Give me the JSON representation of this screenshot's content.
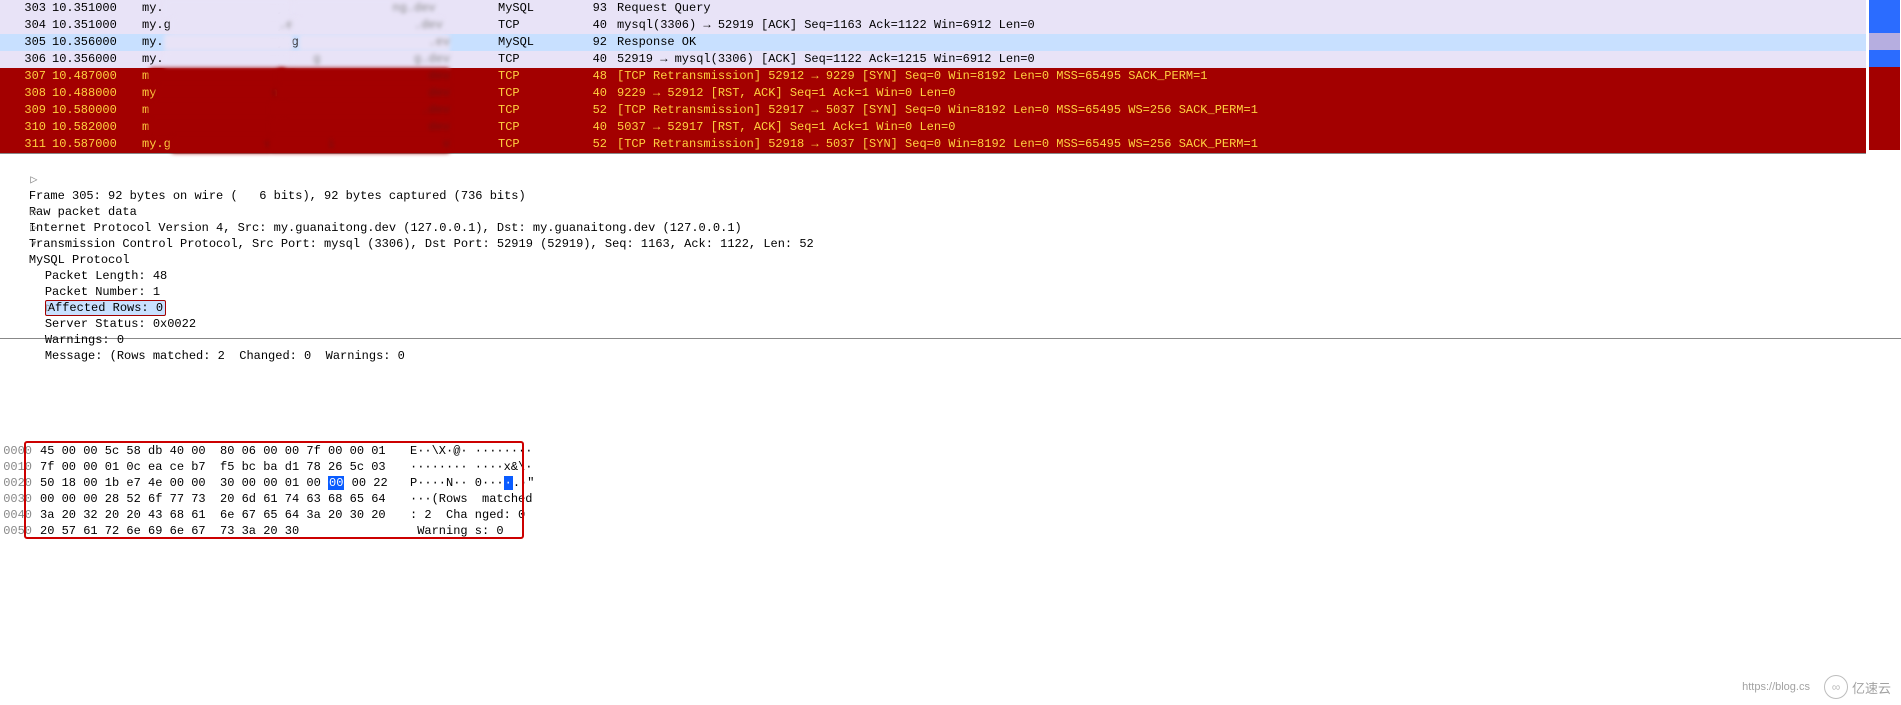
{
  "packet_list": [
    {
      "no": "303",
      "time": "10.351000",
      "src": "my.",
      "src_fade": "                  ",
      "dst": "my.",
      "dst_fade": "              ng.dev",
      "proto": "MySQL",
      "len": "93",
      "info": "Request Query",
      "cls": "normal"
    },
    {
      "no": "304",
      "time": "10.351000",
      "src": "my.g",
      "src_fade": "               .ev",
      "dst": "my.",
      "dst_fade": "                 .dev",
      "proto": "TCP",
      "len": "40",
      "info": "mysql(3306) → 52919 [ACK] Seq=1163 Ack=1122 Win=6912 Len=0",
      "cls": "normal"
    },
    {
      "no": "305",
      "time": "10.356000",
      "src": "my.",
      "src_fade": "                  ",
      "dst": "my.g",
      "dst_fade": "                  .ev",
      "proto": "MySQL",
      "len": "92",
      "info": "Response OK",
      "cls": "selected"
    },
    {
      "no": "306",
      "time": "10.356000",
      "src": "my.",
      "src_fade": "                  ",
      "dst": "my.",
      "dst_fade": "   g             g.dev",
      "proto": "TCP",
      "len": "40",
      "info": "52919 → mysql(3306) [ACK] Seq=1122 Ack=1215 Win=6912 Len=0",
      "cls": "normal"
    },
    {
      "no": "307",
      "time": "10.487000",
      "src": "m",
      "src_fade": "                   ",
      "dst": "m",
      "dst_fade": "                     dev",
      "proto": "TCP",
      "len": "48",
      "info": "[TCP Retransmission] 52912 → 9229 [SYN] Seq=0 Win=8192 Len=0 MSS=65495 SACK_PERM=1",
      "cls": "red"
    },
    {
      "no": "308",
      "time": "10.488000",
      "src": "my",
      "src_fade": "                v",
      "dst": "m",
      "dst_fade": "                     dev",
      "proto": "TCP",
      "len": "40",
      "info": "9229 → 52912 [RST, ACK] Seq=1 Ack=1 Win=0 Len=0",
      "cls": "red"
    },
    {
      "no": "309",
      "time": "10.580000",
      "src": "m",
      "src_fade": "                   ",
      "dst": "",
      "dst_fade": "                     .dev",
      "proto": "TCP",
      "len": "52",
      "info": "[TCP Retransmission] 52917 → 5037 [SYN] Seq=0 Win=8192 Len=0 MSS=65495 WS=256 SACK_PERM=1",
      "cls": "red"
    },
    {
      "no": "310",
      "time": "10.582000",
      "src": "m",
      "src_fade": "                   ",
      "dst": "",
      "dst_fade": "                      dev",
      "proto": "TCP",
      "len": "40",
      "info": "5037 → 52917 [RST, ACK] Seq=1 Ack=1 Win=0 Len=0",
      "cls": "red"
    },
    {
      "no": "311",
      "time": "10.587000",
      "src": "my.g",
      "src_fade": "             v",
      "dst": "",
      "dst_fade": "        i               v",
      "proto": "TCP",
      "len": "52",
      "info": "[TCP Retransmission] 52918 → 5037 [SYN] Seq=0 Win=8192 Len=0 MSS=65495 WS=256 SACK_PERM=1",
      "cls": "red"
    }
  ],
  "details": {
    "frame": "Frame 305: 92 bytes on wire (   6 bits), 92 bytes captured (736 bits)",
    "raw": "Raw packet data",
    "ip": "Internet Protocol Version 4, Src: my.guanaitong.dev (127.0.0.1), Dst: my.guanaitong.dev (127.0.0.1)",
    "tcp": "Transmission Control Protocol, Src Port: mysql (3306), Dst Port: 52919 (52919), Seq: 1163, Ack: 1122, Len: 52",
    "mysql_root": "MySQL Protocol",
    "packet_length": "Packet Length: 48",
    "packet_number": "Packet Number: 1",
    "affected_rows": "Affected Rows: 0",
    "server_status": "Server Status: 0x0022",
    "warnings": "Warnings: 0",
    "message": "Message: (Rows matched: 2  Changed: 0  Warnings: 0"
  },
  "hex": [
    {
      "off": "0000",
      "b1": "45 00 00 5c 58 db 40 00",
      "b2": "80 06 00 00 7f 00 00 01",
      "asc": "E··\\X·@· ········"
    },
    {
      "off": "0010",
      "b1": "7f 00 00 01 0c ea ce b7",
      "b2": "f5 bc ba d1 78 26 5c 03",
      "asc": "········ ····x&\\·"
    },
    {
      "off": "0020",
      "b1": "50 18 00 1b e7 4e 00 00",
      "b2": "30 00 00 01 00 00 00 22",
      "asc": "P····N·· 0····.·\"",
      "sel_idx": 5
    },
    {
      "off": "0030",
      "b1": "00 00 00 28 52 6f 77 73",
      "b2": "20 6d 61 74 63 68 65 64",
      "asc": "···(Rows  matched"
    },
    {
      "off": "0040",
      "b1": "3a 20 32 20 20 43 68 61",
      "b2": "6e 67 65 64 3a 20 30 20",
      "asc": ": 2  Cha nged: 0 "
    },
    {
      "off": "0050",
      "b1": "20 57 61 72 6e 69 6e 67",
      "b2": "73 3a 20 30",
      "asc": " Warning s: 0"
    }
  ],
  "watermark": {
    "url": "https://blog.cs",
    "brand": "亿速云"
  }
}
